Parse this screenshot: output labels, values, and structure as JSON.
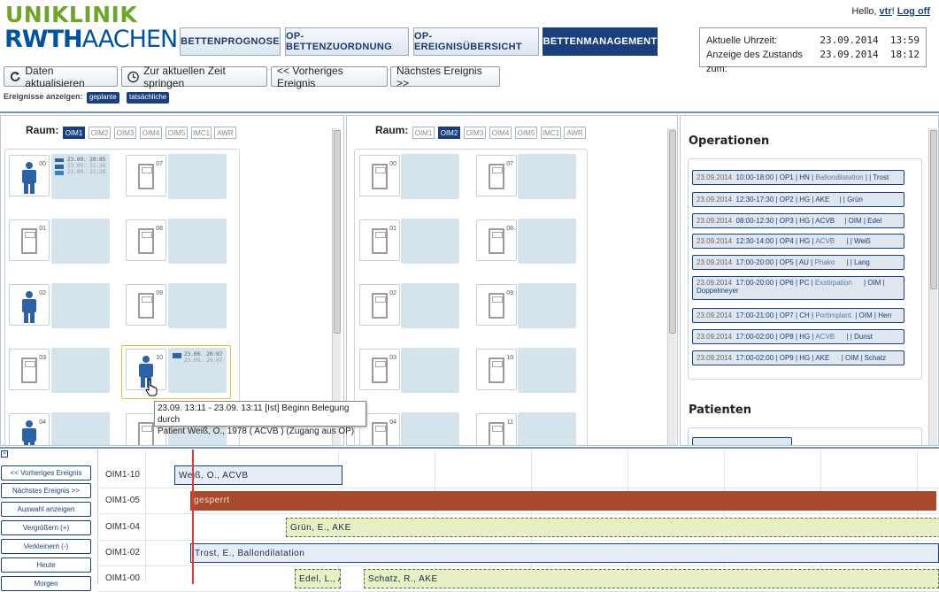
{
  "logo": {
    "line1": "UNIKLINIK",
    "line2a": "RWTH",
    "line2b": "AACHEN"
  },
  "nav": [
    {
      "label": "BETTENPROGNOSE"
    },
    {
      "label": "OP-BETTENZUORDNUNG"
    },
    {
      "label": "OP-EREIGNISÜBERSICHT"
    },
    {
      "label": "BETTENMANAGEMENT"
    }
  ],
  "user": {
    "greeting": "Hello,",
    "name": "vtr",
    "excl": "!",
    "logoff": "Log off"
  },
  "time": {
    "current_label": "Aktuelle Uhrzeit:",
    "current_date": "23.09.2014",
    "current_time": "13:59",
    "state_label": "Anzeige des Zustands zum:",
    "state_date": "23.09.2014",
    "state_time": "18:12"
  },
  "toolbar": {
    "refresh": "Daten aktualisieren",
    "jump": "Zur aktuellen Zeit springen",
    "prev": "<< Vorheriges Ereignis",
    "next": "Nächstes Ereignis >>"
  },
  "events": {
    "label": "Ereignisse anzeigen:",
    "planned": "geplante",
    "actual": "tatsächliche"
  },
  "panel1": {
    "raum": "Raum:",
    "tabs": [
      "OIM1",
      "OIM2",
      "OIM3",
      "OIM4",
      "OIM5",
      "IMC1",
      "AWR"
    ],
    "active": "OIM1",
    "beds": [
      {
        "n": "00"
      },
      {
        "n": "01"
      },
      {
        "n": "02"
      },
      {
        "n": "03"
      },
      {
        "n": "04"
      },
      {
        "n": "07"
      },
      {
        "n": "08"
      },
      {
        "n": "09"
      },
      {
        "n": "10"
      }
    ],
    "ev00": [
      "23.09. 20:05",
      "23.09. 21:26",
      "23.09. 21:26"
    ],
    "ev10": [
      "23.09. 20:07",
      "23.09. 20:07"
    ]
  },
  "panel2": {
    "raum": "Raum:",
    "tabs": [
      "OIM1",
      "OIM2",
      "OIM3",
      "OIM4",
      "OIM5",
      "IMC1",
      "AWR"
    ],
    "active": "OIM2",
    "beds": [
      {
        "n": "00"
      },
      {
        "n": "01"
      },
      {
        "n": "02"
      },
      {
        "n": "03"
      },
      {
        "n": "04"
      },
      {
        "n": "07"
      },
      {
        "n": "08"
      },
      {
        "n": "09"
      },
      {
        "n": "10"
      },
      {
        "n": "11"
      }
    ]
  },
  "tooltip": {
    "line1": "23.09. 13:11 - 23.09. 13:11 [Ist] Beginn Belegung durch",
    "line2": "Patient Weiß, O., 1978 ( ACVB ) (Zugang aus OP)"
  },
  "operations": {
    "title": "Operationen",
    "items": [
      {
        "date": "23.09.2014",
        "text": "10:00-18:00 | OP1 | HN | ",
        "proc": "Ballondilatation",
        "rest": " | | Trost"
      },
      {
        "date": "23.09.2014",
        "text": "12:30-17:30 | OP2 | HG | AKE",
        "proc": "",
        "rest": "     | | Grün"
      },
      {
        "date": "23.09.2014",
        "text": "08:00-12:30 | OP3 | HG | ACVB",
        "proc": "",
        "rest": "     | OIM | Edel"
      },
      {
        "date": "23.09.2014",
        "text": "12:30-14:00 | OP4 | HG | ",
        "proc": "ACVB",
        "rest": "      | | Weiß"
      },
      {
        "date": "23.09.2014",
        "text": "17:00-20:00 | OP5 | AU | ",
        "proc": "Phako",
        "rest": "      | | Lang"
      },
      {
        "date": "23.09.2014",
        "text": "17:00-20:00 | OP6 | PC | ",
        "proc": "Exstirpation",
        "rest": "      | OIM |",
        "rest2": "Doppelmeyer"
      },
      {
        "date": "23.09.2014",
        "text": "17:00-21:00 | OP7 | CH | ",
        "proc": "Portimplant.",
        "rest": " | OIM | Herr"
      },
      {
        "date": "23.09.2014",
        "text": "17:00-02:00 | OP8 | HG | ",
        "proc": "ACVB",
        "rest": "      | | Dunst"
      },
      {
        "date": "23.09.2014",
        "text": "17:00-02:00 | OP9 | HG | AKE",
        "proc": "",
        "rest": "      | OIM | Schatz"
      }
    ]
  },
  "patients": {
    "title": "Patienten"
  },
  "gantt": {
    "buttons": [
      "<< Vorheriges Ereignis",
      "Nächstes Ereignis >>",
      "Auswahl anzeigen",
      "Vergrößern (+)",
      "Verkleinern (-)",
      "Heute",
      "Morgen"
    ],
    "rows": [
      {
        "label": "OIM1-10",
        "bars": [
          {
            "text": "Weiß, O.,  ACVB"
          }
        ]
      },
      {
        "label": "OIM1-05",
        "bars": [
          {
            "text": "gesperrt"
          }
        ]
      },
      {
        "label": "OIM1-04",
        "bars": [
          {
            "text": "Grün, E.,  AKE"
          }
        ]
      },
      {
        "label": "OIM1-02",
        "bars": [
          {
            "text": "Trost, E.,  Ballondilatation"
          }
        ]
      },
      {
        "label": "OIM1-00",
        "bars": [
          {
            "text": "Edel, L.,  A"
          },
          {
            "text": "Schatz, R.,  AKE"
          }
        ]
      }
    ]
  },
  "colors": {
    "navy": "#1a3f7d",
    "logo_green": "#6fa52a",
    "logo_blue": "#00549f",
    "slot_bg": "#d4e3ec",
    "blocked": "#a84a2c",
    "planned_bar": "#e6f0c4",
    "now_line": "#e03b30"
  }
}
